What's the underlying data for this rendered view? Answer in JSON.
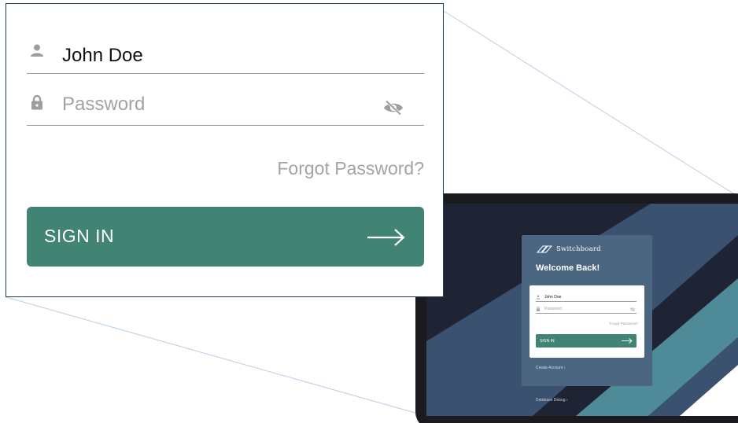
{
  "login": {
    "username_value": "John Doe",
    "password_placeholder": "Password",
    "forgot_password": "Forgot Password?",
    "sign_in_label": "SIGN IN"
  },
  "tablet": {
    "brand_name": "Switchboard",
    "welcome_title": "Welcome Back!",
    "username_value": "John Doe",
    "password_placeholder": "Password",
    "forgot_password": "Forgot Password?",
    "sign_in_label": "SIGN IN",
    "create_account": "Create Account ›",
    "database_debug": "Database Debug ›"
  },
  "icons": {
    "user": "person-icon",
    "password": "lock-icon",
    "visibility": "eye-off-icon",
    "submit": "arrow-right-icon",
    "brand": "switchboard-logo"
  },
  "colors": {
    "accent": "#428473",
    "card": "#4a6680",
    "screen_dark": "#1e2433",
    "screen_blue": "#3a5170",
    "screen_teal": "#4f8a99",
    "panel_border": "#1f3a57",
    "muted_text": "#a3a3a3"
  }
}
